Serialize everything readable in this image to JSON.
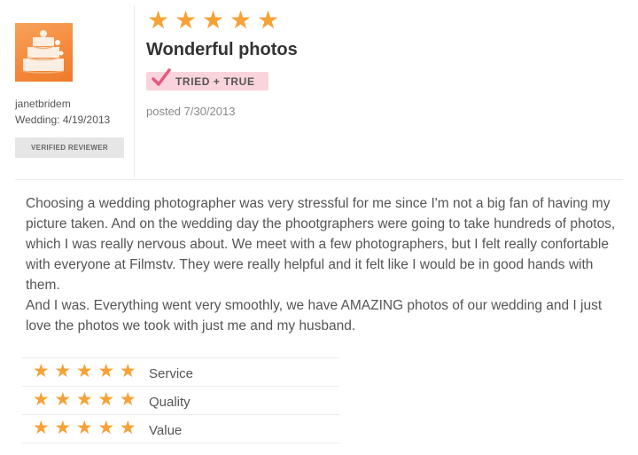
{
  "reviewer": {
    "username": "janetbridem",
    "wedding_label": "Wedding:",
    "wedding_date": "4/19/2013",
    "verified_label": "VERIFIED REVIEWER"
  },
  "review": {
    "overall_rating": 5,
    "star_glyph": "★",
    "title": "Wonderful photos",
    "badge_label": "TRIED + TRUE",
    "posted": "posted 7/30/2013",
    "paragraphs": [
      "Choosing a wedding photographer was very stressful for me since I'm not a big fan of having my picture taken. And on the wedding day the phootgraphers were going to take hundreds of photos, which I was really nervous about. We meet with a few photographers, but I felt really confortable with everyone at Filmstv. They were really helpful and it felt like I would be in good hands with them.",
      "And I was. Everything went very smoothly, we have AMAZING photos of our wedding and I just love the photos we took with just me and my husband."
    ]
  },
  "ratings": [
    {
      "label": "Service",
      "stars": 5
    },
    {
      "label": "Quality",
      "stars": 5
    },
    {
      "label": "Value",
      "stars": 5
    }
  ],
  "colors": {
    "star": "#f7a136",
    "badge_pink": "#fad4dd",
    "check_pink": "#e8577e",
    "avatar_orange": "#f58a3c"
  },
  "icons": {
    "avatar": "wedding-cake-avatar",
    "check": "checkmark-icon",
    "star": "star-icon"
  }
}
